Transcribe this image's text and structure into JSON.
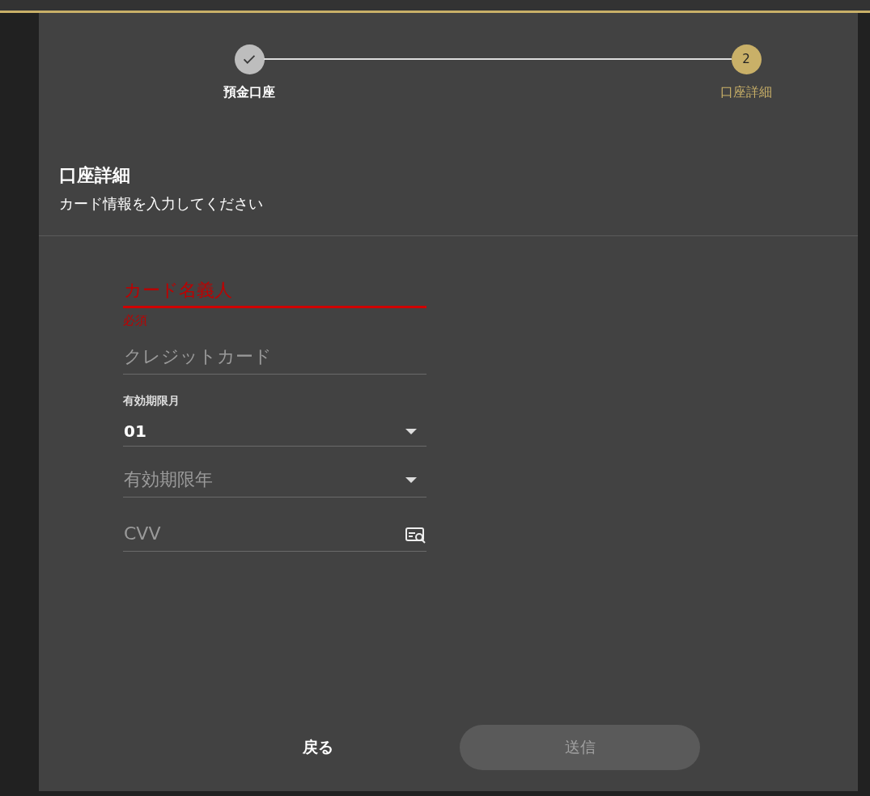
{
  "stepper": {
    "steps": [
      {
        "label": "預金口座",
        "done": true,
        "selected": false
      },
      {
        "label": "口座詳細",
        "done": false,
        "selected": true,
        "number": "2"
      }
    ]
  },
  "section": {
    "title": "口座詳細",
    "subtitle": "カード情報を入力してください"
  },
  "fields": [
    {
      "kind": "text",
      "placeholder": "カード名義人",
      "invalid": true,
      "error": "必須"
    },
    {
      "kind": "text",
      "placeholder": "クレジットカード",
      "invalid": false
    },
    {
      "kind": "select",
      "label": "有効期限月",
      "value": "01"
    },
    {
      "kind": "select",
      "placeholder": "有効期限年"
    },
    {
      "kind": "cvv",
      "placeholder": "CVV",
      "invalid": false
    }
  ],
  "buttons": {
    "back": {
      "label": "戻る"
    },
    "submit": {
      "label": "送信",
      "disabled": true
    }
  }
}
